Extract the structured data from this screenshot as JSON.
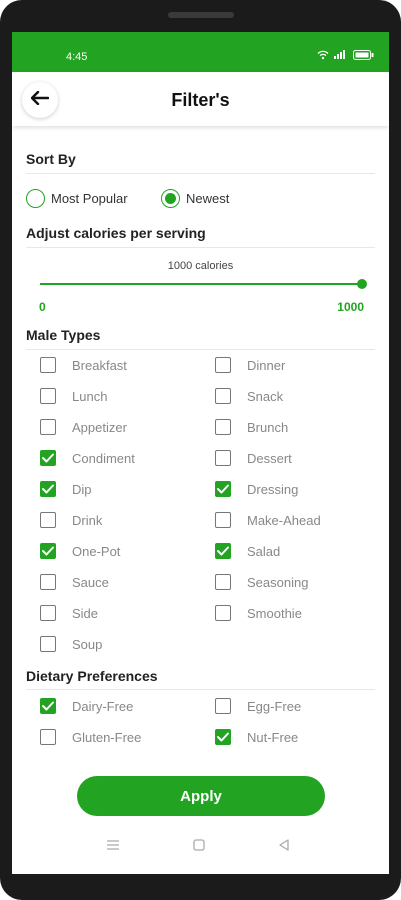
{
  "status_bar": {
    "time": "4:45",
    "icons": [
      "wifi-icon",
      "signal-icon",
      "battery-icon"
    ]
  },
  "header": {
    "title": "Filter's",
    "back_icon": "arrow-left-icon"
  },
  "sort": {
    "title": "Sort By",
    "options": [
      {
        "label": "Most Popular",
        "selected": false
      },
      {
        "label": "Newest",
        "selected": true
      }
    ]
  },
  "calories": {
    "title": "Adjust calories per serving",
    "value_label": "1000 calories",
    "min": "0",
    "max": "1000",
    "value": 1000
  },
  "meal_types": {
    "title": "Male Types",
    "items": [
      {
        "label": "Breakfast",
        "checked": false
      },
      {
        "label": "Dinner",
        "checked": false
      },
      {
        "label": "Lunch",
        "checked": false
      },
      {
        "label": "Snack",
        "checked": false
      },
      {
        "label": "Appetizer",
        "checked": false
      },
      {
        "label": "Brunch",
        "checked": false
      },
      {
        "label": "Condiment",
        "checked": true
      },
      {
        "label": "Dessert",
        "checked": false
      },
      {
        "label": "Dip",
        "checked": true
      },
      {
        "label": "Dressing",
        "checked": true
      },
      {
        "label": "Drink",
        "checked": false
      },
      {
        "label": "Make-Ahead",
        "checked": false
      },
      {
        "label": "One-Pot",
        "checked": true
      },
      {
        "label": "Salad",
        "checked": true
      },
      {
        "label": "Sauce",
        "checked": false
      },
      {
        "label": "Seasoning",
        "checked": false
      },
      {
        "label": "Side",
        "checked": false
      },
      {
        "label": "Smoothie",
        "checked": false
      },
      {
        "label": "Soup",
        "checked": false
      }
    ]
  },
  "dietary": {
    "title": "Dietary Preferences",
    "items": [
      {
        "label": "Dairy-Free",
        "checked": true
      },
      {
        "label": "Egg-Free",
        "checked": false
      },
      {
        "label": "Gluten-Free",
        "checked": false
      },
      {
        "label": "Nut-Free",
        "checked": true
      }
    ]
  },
  "apply_label": "Apply",
  "nav_bar": [
    "menu-icon",
    "home-square-icon",
    "back-triangle-icon"
  ],
  "colors": {
    "accent": "#22a322",
    "text": "#222222",
    "muted": "#888888"
  }
}
